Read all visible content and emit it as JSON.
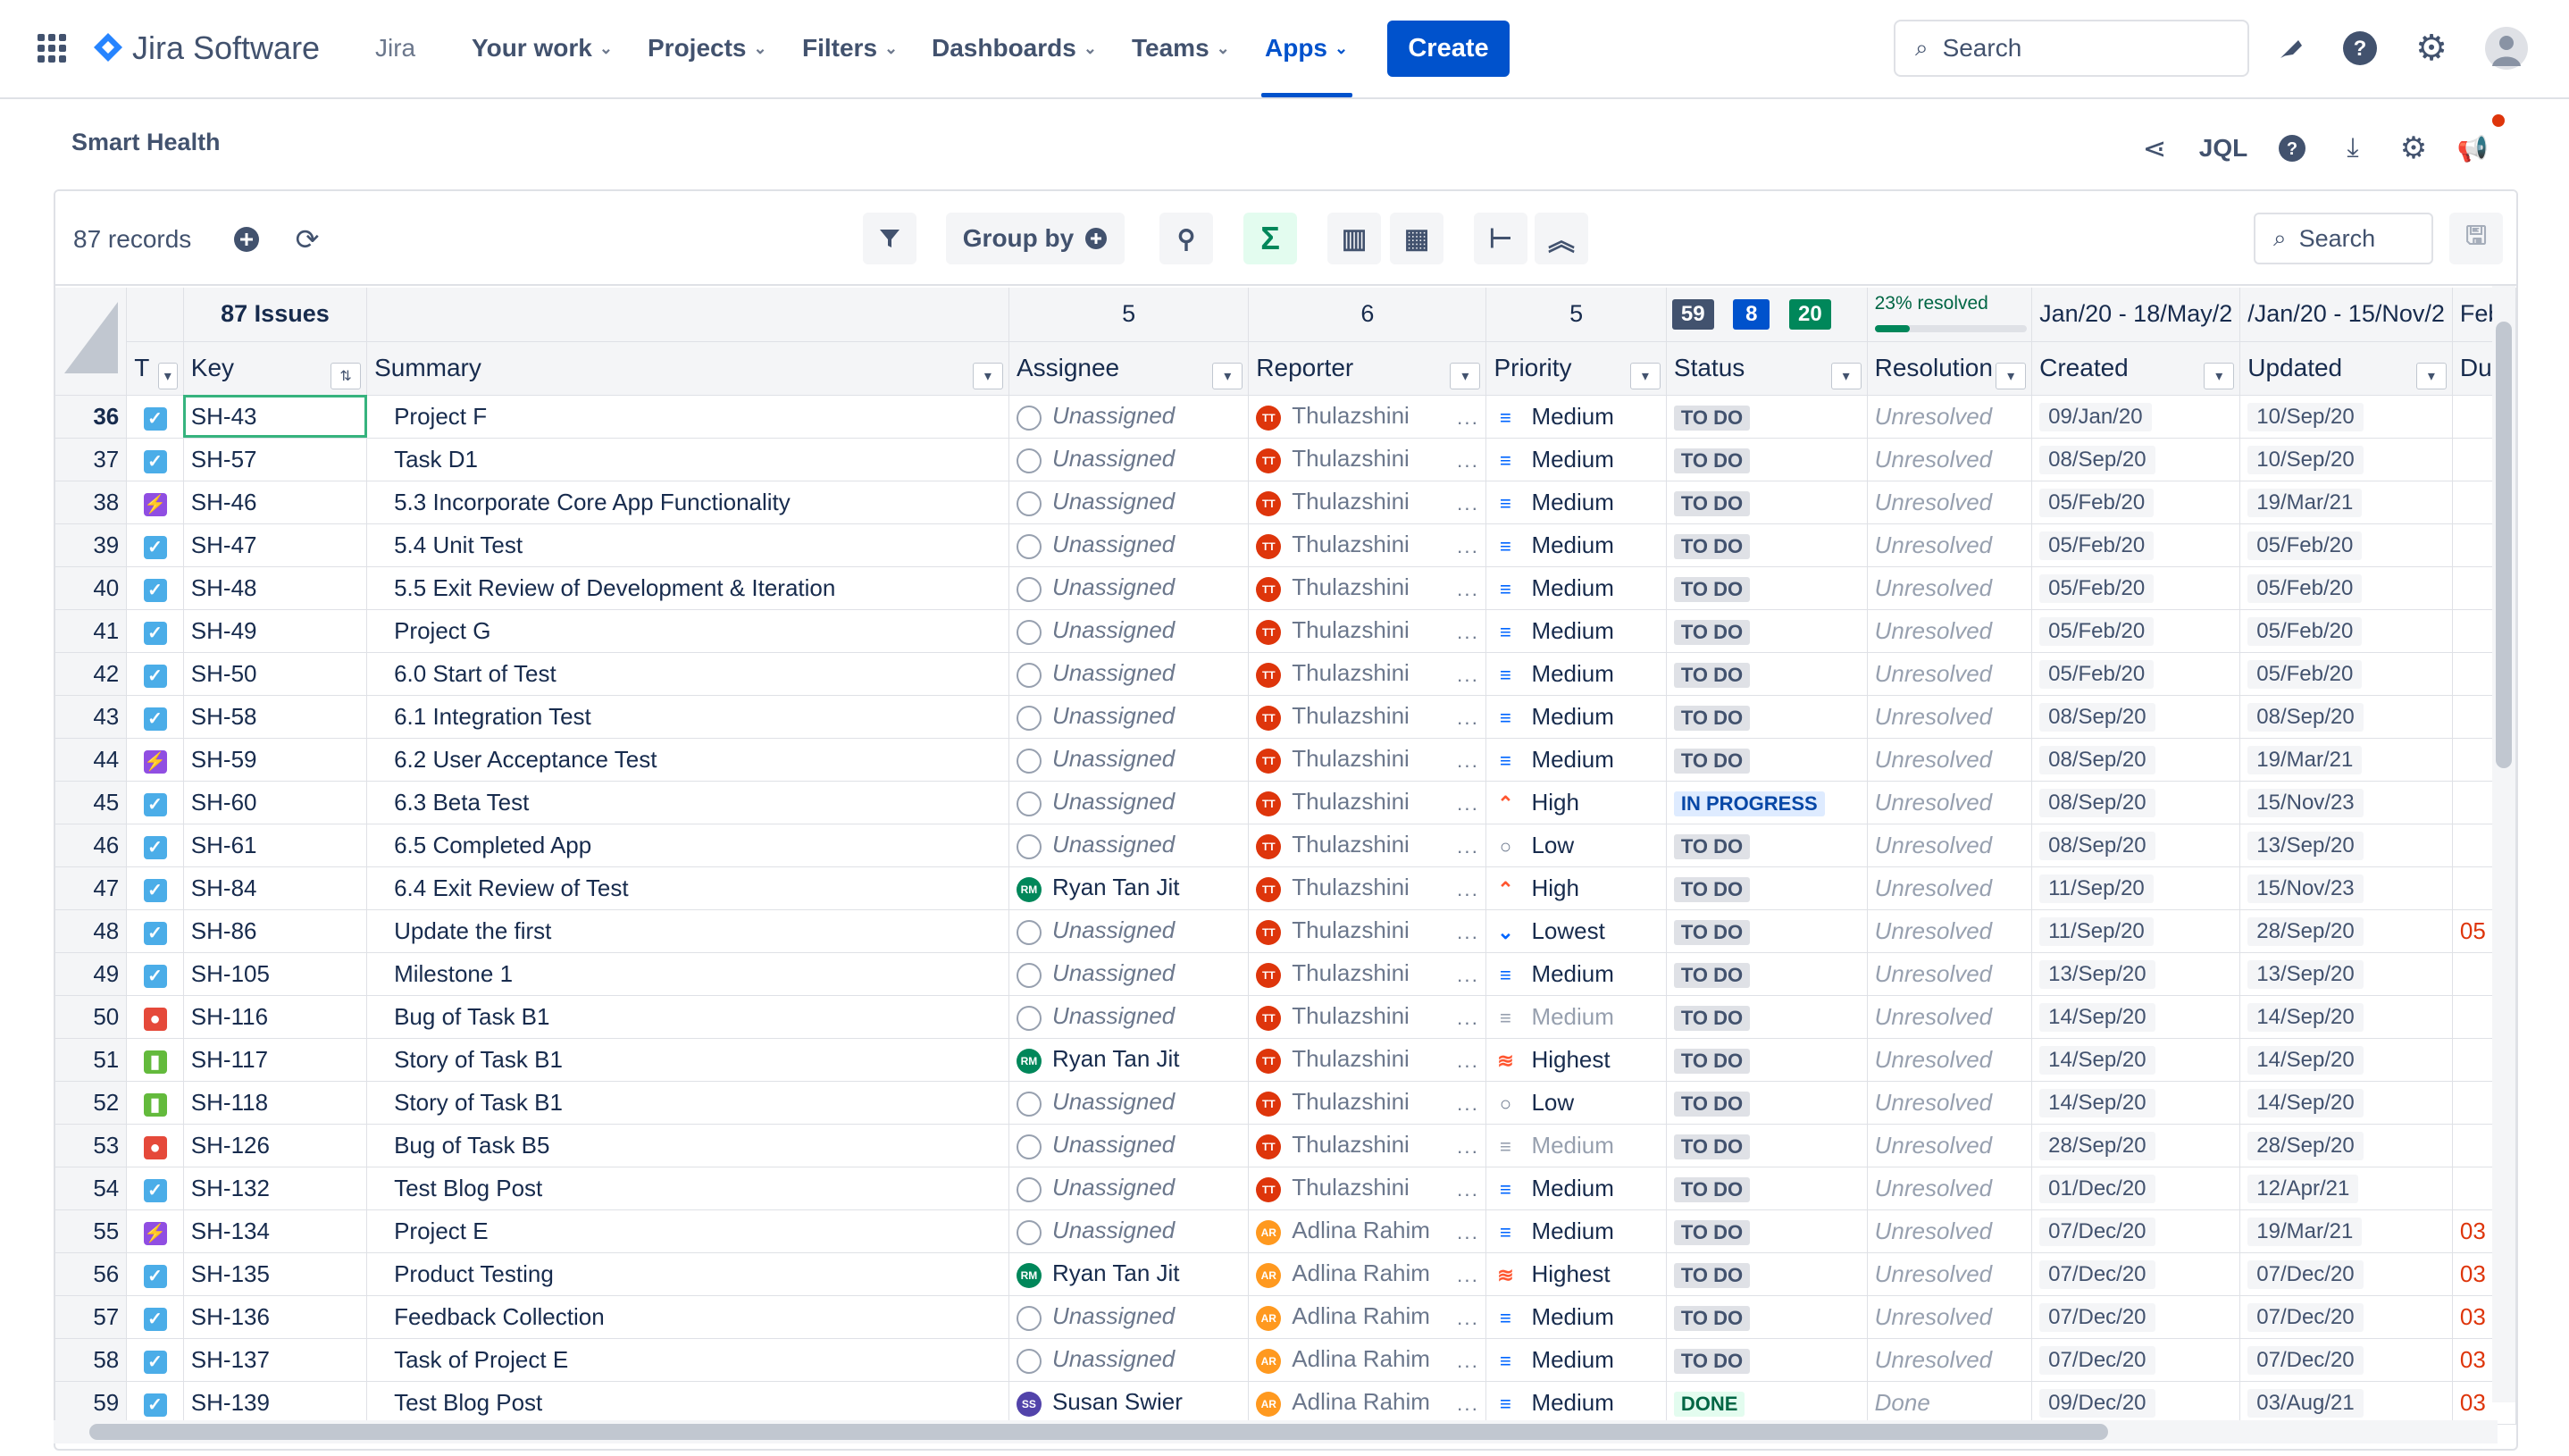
{
  "nav": {
    "product": "Jira Software",
    "jira": "Jira",
    "items": [
      "Your work",
      "Projects",
      "Filters",
      "Dashboards",
      "Teams",
      "Apps"
    ],
    "create": "Create",
    "search_placeholder": "Search"
  },
  "page": {
    "title": "Smart Health",
    "jql": "JQL"
  },
  "toolbar": {
    "records": "87 records",
    "group_by": "Group by",
    "search_placeholder": "Search"
  },
  "summary_row": {
    "issues": "87 Issues",
    "assignee": "5",
    "reporter": "6",
    "priority": "5",
    "status_counts": [
      "59",
      "8",
      "20"
    ],
    "status_colors": [
      "#42526E",
      "#0052CC",
      "#00875A"
    ],
    "resolved": "23% resolved",
    "resolved_fraction": 0.23,
    "created_range": "Jan/20 - 18/May/2",
    "updated_range": "/Jan/20 - 15/Nov/2",
    "due_range": "Feb/"
  },
  "columns": [
    "T",
    "Key",
    "Summary",
    "Assignee",
    "Reporter",
    "Priority",
    "Status",
    "Resolution",
    "Created",
    "Updated",
    "Due"
  ],
  "rows": [
    {
      "n": "36",
      "type": "task",
      "key": "SH-43",
      "summary": "Project F",
      "assignee": "Unassigned",
      "av": "un",
      "reporter": "Thulazshini",
      "rav": "tt",
      "priority": "Medium",
      "pcls": "med",
      "status": "TO DO",
      "resolution": "Unresolved",
      "created": "09/Jan/20",
      "updated": "10/Sep/20",
      "due": ""
    },
    {
      "n": "37",
      "type": "task",
      "key": "SH-57",
      "summary": "Task D1",
      "assignee": "Unassigned",
      "av": "un",
      "reporter": "Thulazshini",
      "rav": "tt",
      "priority": "Medium",
      "pcls": "med",
      "status": "TO DO",
      "resolution": "Unresolved",
      "created": "08/Sep/20",
      "updated": "10/Sep/20",
      "due": ""
    },
    {
      "n": "38",
      "type": "epic",
      "key": "SH-46",
      "summary": "5.3 Incorporate Core App Functionality",
      "assignee": "Unassigned",
      "av": "un",
      "reporter": "Thulazshini",
      "rav": "tt",
      "priority": "Medium",
      "pcls": "med",
      "status": "TO DO",
      "resolution": "Unresolved",
      "created": "05/Feb/20",
      "updated": "19/Mar/21",
      "due": ""
    },
    {
      "n": "39",
      "type": "task",
      "key": "SH-47",
      "summary": "5.4 Unit Test",
      "assignee": "Unassigned",
      "av": "un",
      "reporter": "Thulazshini",
      "rav": "tt",
      "priority": "Medium",
      "pcls": "med",
      "status": "TO DO",
      "resolution": "Unresolved",
      "created": "05/Feb/20",
      "updated": "05/Feb/20",
      "due": ""
    },
    {
      "n": "40",
      "type": "task",
      "key": "SH-48",
      "summary": "5.5 Exit Review of Development & Iteration",
      "assignee": "Unassigned",
      "av": "un",
      "reporter": "Thulazshini",
      "rav": "tt",
      "priority": "Medium",
      "pcls": "med",
      "status": "TO DO",
      "resolution": "Unresolved",
      "created": "05/Feb/20",
      "updated": "05/Feb/20",
      "due": ""
    },
    {
      "n": "41",
      "type": "task",
      "key": "SH-49",
      "summary": "Project G",
      "assignee": "Unassigned",
      "av": "un",
      "reporter": "Thulazshini",
      "rav": "tt",
      "priority": "Medium",
      "pcls": "med",
      "status": "TO DO",
      "resolution": "Unresolved",
      "created": "05/Feb/20",
      "updated": "05/Feb/20",
      "due": ""
    },
    {
      "n": "42",
      "type": "task",
      "key": "SH-50",
      "summary": "6.0 Start of Test",
      "assignee": "Unassigned",
      "av": "un",
      "reporter": "Thulazshini",
      "rav": "tt",
      "priority": "Medium",
      "pcls": "med",
      "status": "TO DO",
      "resolution": "Unresolved",
      "created": "05/Feb/20",
      "updated": "05/Feb/20",
      "due": ""
    },
    {
      "n": "43",
      "type": "task",
      "key": "SH-58",
      "summary": "6.1 Integration Test",
      "assignee": "Unassigned",
      "av": "un",
      "reporter": "Thulazshini",
      "rav": "tt",
      "priority": "Medium",
      "pcls": "med",
      "status": "TO DO",
      "resolution": "Unresolved",
      "created": "08/Sep/20",
      "updated": "08/Sep/20",
      "due": ""
    },
    {
      "n": "44",
      "type": "epic",
      "key": "SH-59",
      "summary": "6.2 User Acceptance Test",
      "assignee": "Unassigned",
      "av": "un",
      "reporter": "Thulazshini",
      "rav": "tt",
      "priority": "Medium",
      "pcls": "med",
      "status": "TO DO",
      "resolution": "Unresolved",
      "created": "08/Sep/20",
      "updated": "19/Mar/21",
      "due": ""
    },
    {
      "n": "45",
      "type": "task",
      "key": "SH-60",
      "summary": "6.3 Beta Test",
      "assignee": "Unassigned",
      "av": "un",
      "reporter": "Thulazshini",
      "rav": "tt",
      "priority": "High",
      "pcls": "high",
      "status": "IN PROGRESS",
      "resolution": "Unresolved",
      "created": "08/Sep/20",
      "updated": "15/Nov/23",
      "due": ""
    },
    {
      "n": "46",
      "type": "task",
      "key": "SH-61",
      "summary": "6.5 Completed App",
      "assignee": "Unassigned",
      "av": "un",
      "reporter": "Thulazshini",
      "rav": "tt",
      "priority": "Low",
      "pcls": "low",
      "status": "TO DO",
      "resolution": "Unresolved",
      "created": "08/Sep/20",
      "updated": "13/Sep/20",
      "due": ""
    },
    {
      "n": "47",
      "type": "task",
      "key": "SH-84",
      "summary": "6.4 Exit Review of Test",
      "assignee": "Ryan Tan Jit",
      "av": "rm",
      "reporter": "Thulazshini",
      "rav": "tt",
      "priority": "High",
      "pcls": "high",
      "status": "TO DO",
      "resolution": "Unresolved",
      "created": "11/Sep/20",
      "updated": "15/Nov/23",
      "due": ""
    },
    {
      "n": "48",
      "type": "task",
      "key": "SH-86",
      "summary": "Update the first",
      "assignee": "Unassigned",
      "av": "un",
      "reporter": "Thulazshini",
      "rav": "tt",
      "priority": "Lowest",
      "pcls": "lowest",
      "status": "TO DO",
      "resolution": "Unresolved",
      "created": "11/Sep/20",
      "updated": "28/Sep/20",
      "due": "05"
    },
    {
      "n": "49",
      "type": "task",
      "key": "SH-105",
      "summary": "Milestone 1",
      "assignee": "Unassigned",
      "av": "un",
      "reporter": "Thulazshini",
      "rav": "tt",
      "priority": "Medium",
      "pcls": "med",
      "status": "TO DO",
      "resolution": "Unresolved",
      "created": "13/Sep/20",
      "updated": "13/Sep/20",
      "due": ""
    },
    {
      "n": "50",
      "type": "bug",
      "key": "SH-116",
      "summary": "Bug of Task B1",
      "assignee": "Unassigned",
      "av": "un",
      "reporter": "Thulazshini",
      "rav": "tt",
      "priority": "Medium",
      "pcls": "medg",
      "status": "TO DO",
      "resolution": "Unresolved",
      "created": "14/Sep/20",
      "updated": "14/Sep/20",
      "due": ""
    },
    {
      "n": "51",
      "type": "story",
      "key": "SH-117",
      "summary": "Story of Task B1",
      "assignee": "Ryan Tan Jit",
      "av": "rm",
      "reporter": "Thulazshini",
      "rav": "tt",
      "priority": "Highest",
      "pcls": "highest",
      "status": "TO DO",
      "resolution": "Unresolved",
      "created": "14/Sep/20",
      "updated": "14/Sep/20",
      "due": ""
    },
    {
      "n": "52",
      "type": "story",
      "key": "SH-118",
      "summary": "Story of Task B1",
      "assignee": "Unassigned",
      "av": "un",
      "reporter": "Thulazshini",
      "rav": "tt",
      "priority": "Low",
      "pcls": "low",
      "status": "TO DO",
      "resolution": "Unresolved",
      "created": "14/Sep/20",
      "updated": "14/Sep/20",
      "due": ""
    },
    {
      "n": "53",
      "type": "bug",
      "key": "SH-126",
      "summary": "Bug of Task B5",
      "assignee": "Unassigned",
      "av": "un",
      "reporter": "Thulazshini",
      "rav": "tt",
      "priority": "Medium",
      "pcls": "medg",
      "status": "TO DO",
      "resolution": "Unresolved",
      "created": "28/Sep/20",
      "updated": "28/Sep/20",
      "due": ""
    },
    {
      "n": "54",
      "type": "task",
      "key": "SH-132",
      "summary": "Test Blog Post",
      "assignee": "Unassigned",
      "av": "un",
      "reporter": "Thulazshini",
      "rav": "tt",
      "priority": "Medium",
      "pcls": "med",
      "status": "TO DO",
      "resolution": "Unresolved",
      "created": "01/Dec/20",
      "updated": "12/Apr/21",
      "due": ""
    },
    {
      "n": "55",
      "type": "epic",
      "key": "SH-134",
      "summary": "Project E",
      "assignee": "Unassigned",
      "av": "un",
      "reporter": "Adlina Rahim",
      "rav": "ar",
      "priority": "Medium",
      "pcls": "med",
      "status": "TO DO",
      "resolution": "Unresolved",
      "created": "07/Dec/20",
      "updated": "19/Mar/21",
      "due": "03"
    },
    {
      "n": "56",
      "type": "task",
      "key": "SH-135",
      "summary": "Product Testing",
      "assignee": "Ryan Tan Jit",
      "av": "rm",
      "reporter": "Adlina Rahim",
      "rav": "ar",
      "priority": "Highest",
      "pcls": "highest",
      "status": "TO DO",
      "resolution": "Unresolved",
      "created": "07/Dec/20",
      "updated": "07/Dec/20",
      "due": "03"
    },
    {
      "n": "57",
      "type": "task",
      "key": "SH-136",
      "summary": "Feedback Collection",
      "assignee": "Unassigned",
      "av": "un",
      "reporter": "Adlina Rahim",
      "rav": "ar",
      "priority": "Medium",
      "pcls": "med",
      "status": "TO DO",
      "resolution": "Unresolved",
      "created": "07/Dec/20",
      "updated": "07/Dec/20",
      "due": "03"
    },
    {
      "n": "58",
      "type": "task",
      "key": "SH-137",
      "summary": "Task of Project E",
      "assignee": "Unassigned",
      "av": "un",
      "reporter": "Adlina Rahim",
      "rav": "ar",
      "priority": "Medium",
      "pcls": "med",
      "status": "TO DO",
      "resolution": "Unresolved",
      "created": "07/Dec/20",
      "updated": "07/Dec/20",
      "due": "03"
    },
    {
      "n": "59",
      "type": "task",
      "key": "SH-139",
      "summary": "Test Blog Post",
      "assignee": "Susan Swier",
      "av": "ss",
      "reporter": "Adlina Rahim",
      "rav": "ar",
      "priority": "Medium",
      "pcls": "med",
      "status": "DONE",
      "resolution": "Done",
      "created": "09/Dec/20",
      "updated": "03/Aug/21",
      "due": "03"
    }
  ]
}
